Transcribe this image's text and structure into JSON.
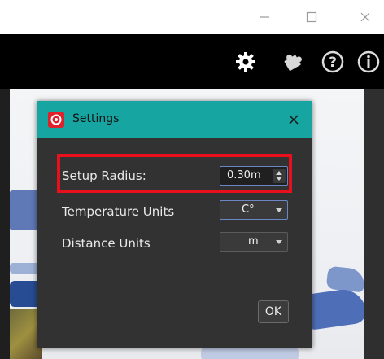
{
  "window": {
    "controls": {
      "minimize": "—",
      "maximize": "☐",
      "close": "✕"
    }
  },
  "toolbar": {
    "icons": [
      "gear-icon",
      "puzzle-icon",
      "help-icon",
      "info-icon"
    ]
  },
  "dialog": {
    "title": "Settings",
    "close_glyph": "✕",
    "setup_radius": {
      "label": "Setup Radius:",
      "value": "0.30m"
    },
    "temperature_units": {
      "label": "Temperature Units",
      "value": "C°"
    },
    "distance_units": {
      "label": "Distance Units",
      "value": "m"
    },
    "ok_label": "OK"
  },
  "colors": {
    "dialog_title_bg": "#16a5a0",
    "highlight_border": "#e8101d",
    "focus_border": "#6a86c4"
  }
}
